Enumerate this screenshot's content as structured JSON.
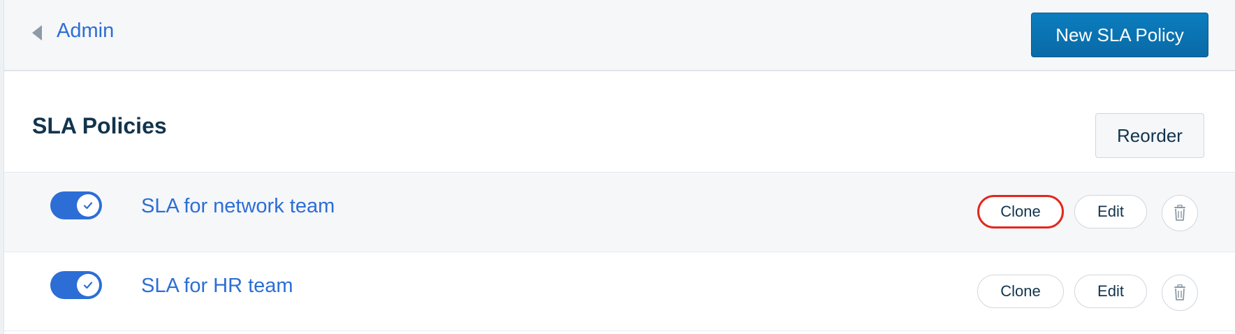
{
  "header": {
    "breadcrumb_label": "Admin",
    "new_policy_label": "New SLA Policy"
  },
  "page": {
    "title": "SLA Policies",
    "reorder_label": "Reorder"
  },
  "policies": [
    {
      "name": "SLA for network team",
      "enabled": true,
      "clone_label": "Clone",
      "edit_label": "Edit",
      "clone_highlighted": true
    },
    {
      "name": "SLA for HR team",
      "enabled": true,
      "clone_label": "Clone",
      "edit_label": "Edit",
      "clone_highlighted": false
    }
  ],
  "colors": {
    "accent": "#2c6ed5",
    "primary_button": "#0a72b0",
    "highlight_outline": "#e3271d"
  },
  "icons": {
    "back": "caret-left-icon",
    "toggle_on": "check-icon",
    "delete": "trash-icon"
  }
}
